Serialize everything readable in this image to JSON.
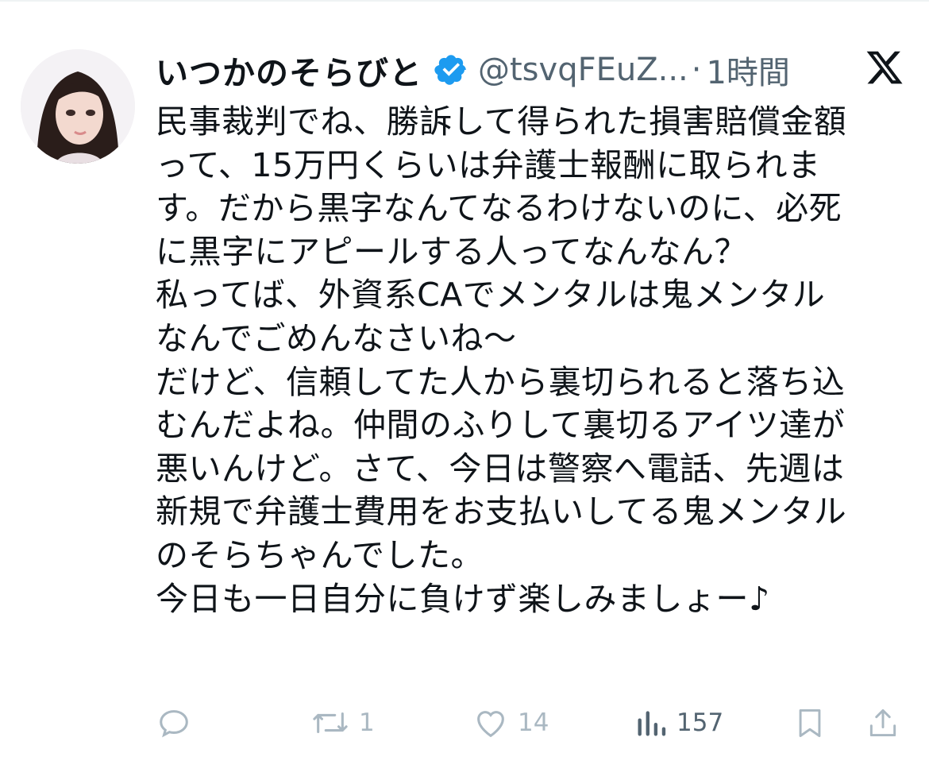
{
  "tweet": {
    "display_name": "いつかのそらびと",
    "handle": "@tsvqFEuZ...",
    "separator": "·",
    "time": "1時間",
    "verified": true,
    "body_lines": [
      "民事裁判でね、勝訴して得られた損害賠償金額",
      "って、15万円くらいは弁護士報酬に取られま",
      "す。だから黒字なんてなるわけないのに、必死",
      "に黒字にアピールする人ってなんなん？",
      "私ってば、外資系CAでメンタルは鬼メンタル",
      "なんでごめんなさいね〜",
      "だけど、信頼してた人から裏切られると落ち込",
      "むんだよね。仲間のふりして裏切るアイツ達が",
      "悪いんけど。さて、今日は警察へ電話、先週は",
      "新規で弁護士費用をお支払いしてる鬼メンタル",
      "のそらちゃんでした。",
      "今日も一日自分に負けず楽しみましょー♪"
    ]
  },
  "actions": {
    "reply_count": "",
    "retweet_count": "1",
    "like_count": "14",
    "view_count": "157"
  },
  "icons": {
    "verified": "verified-badge-icon",
    "brand": "x-logo-icon",
    "reply": "reply-icon",
    "retweet": "retweet-icon",
    "like": "heart-icon",
    "views": "views-icon",
    "bookmark": "bookmark-icon",
    "share": "share-icon"
  },
  "colors": {
    "text": "#0f1419",
    "secondary": "#536471",
    "faded_icons": "#aab8c2",
    "verified": "#1d9bf0"
  }
}
